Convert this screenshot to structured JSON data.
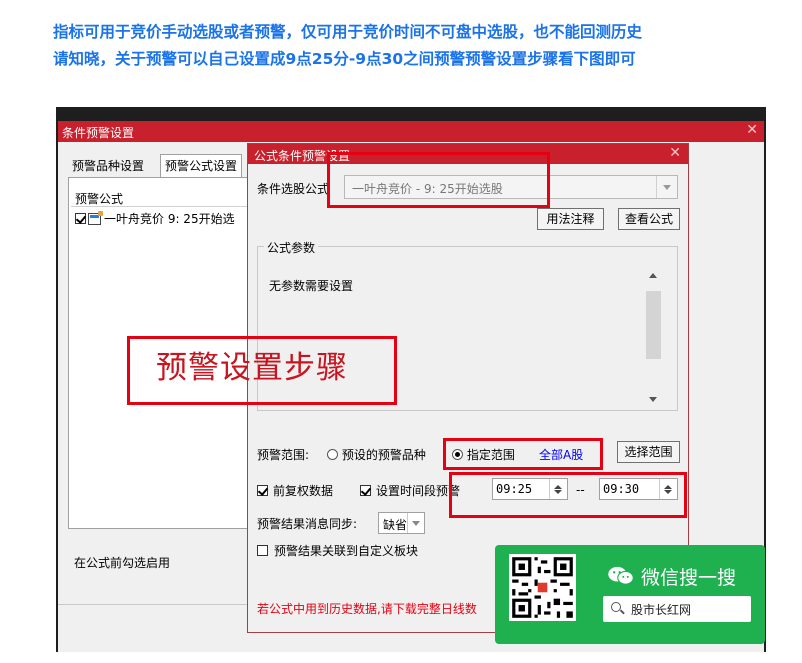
{
  "intro": {
    "line1": "指标可用于竞价手动选股或者预警，仅可用于竞价时间不可盘中选股，也不能回测历史",
    "line2": "请知晓，关于预警可以自己设置成9点25分-9点30之间预警预警设置步骤看下图即可"
  },
  "outer_window": {
    "title": "条件预警设置",
    "tabs": [
      "预警品种设置",
      "预警公式设置"
    ],
    "list_header": "预警公式",
    "list_item": "一叶舟竞价 9: 25开始选",
    "footer_text": "在公式前勾选启用"
  },
  "inner_dialog": {
    "title": "公式条件预警设置",
    "formula_label": "条件选股公式",
    "formula_value": "一叶舟竞价 - 9: 25开始选股",
    "usage_button": "用法注释",
    "view_button": "查看公式",
    "params_group_label": "公式参数",
    "params_text": "无参数需要设置",
    "range_label": "预警范围:",
    "range_option_preset": "预设的预警品种",
    "range_option_custom": "指定范围",
    "range_value": "全部A股",
    "select_range_button": "选择范围",
    "prereight_label": "前复权数据",
    "time_period_label": "设置时间段预警",
    "time_start": "09:25",
    "time_separator": "--",
    "time_end": "09:30",
    "sync_label": "预警结果消息同步:",
    "sync_value": "缺省",
    "link_block_label": "预警结果关联到自定义板块",
    "warning_text": "若公式中用到历史数据,请下载完整日线数"
  },
  "annotation": {
    "big_label": "预警设置步骤"
  },
  "watermark": {
    "brand": "微信搜一搜",
    "search_text": "股市长红网"
  },
  "colors": {
    "intro_blue": "#1a73e8",
    "title_red": "#c8202c",
    "annotation_red": "#e50012",
    "link_blue": "#0000ff",
    "wechat_green": "#1fb04f"
  }
}
